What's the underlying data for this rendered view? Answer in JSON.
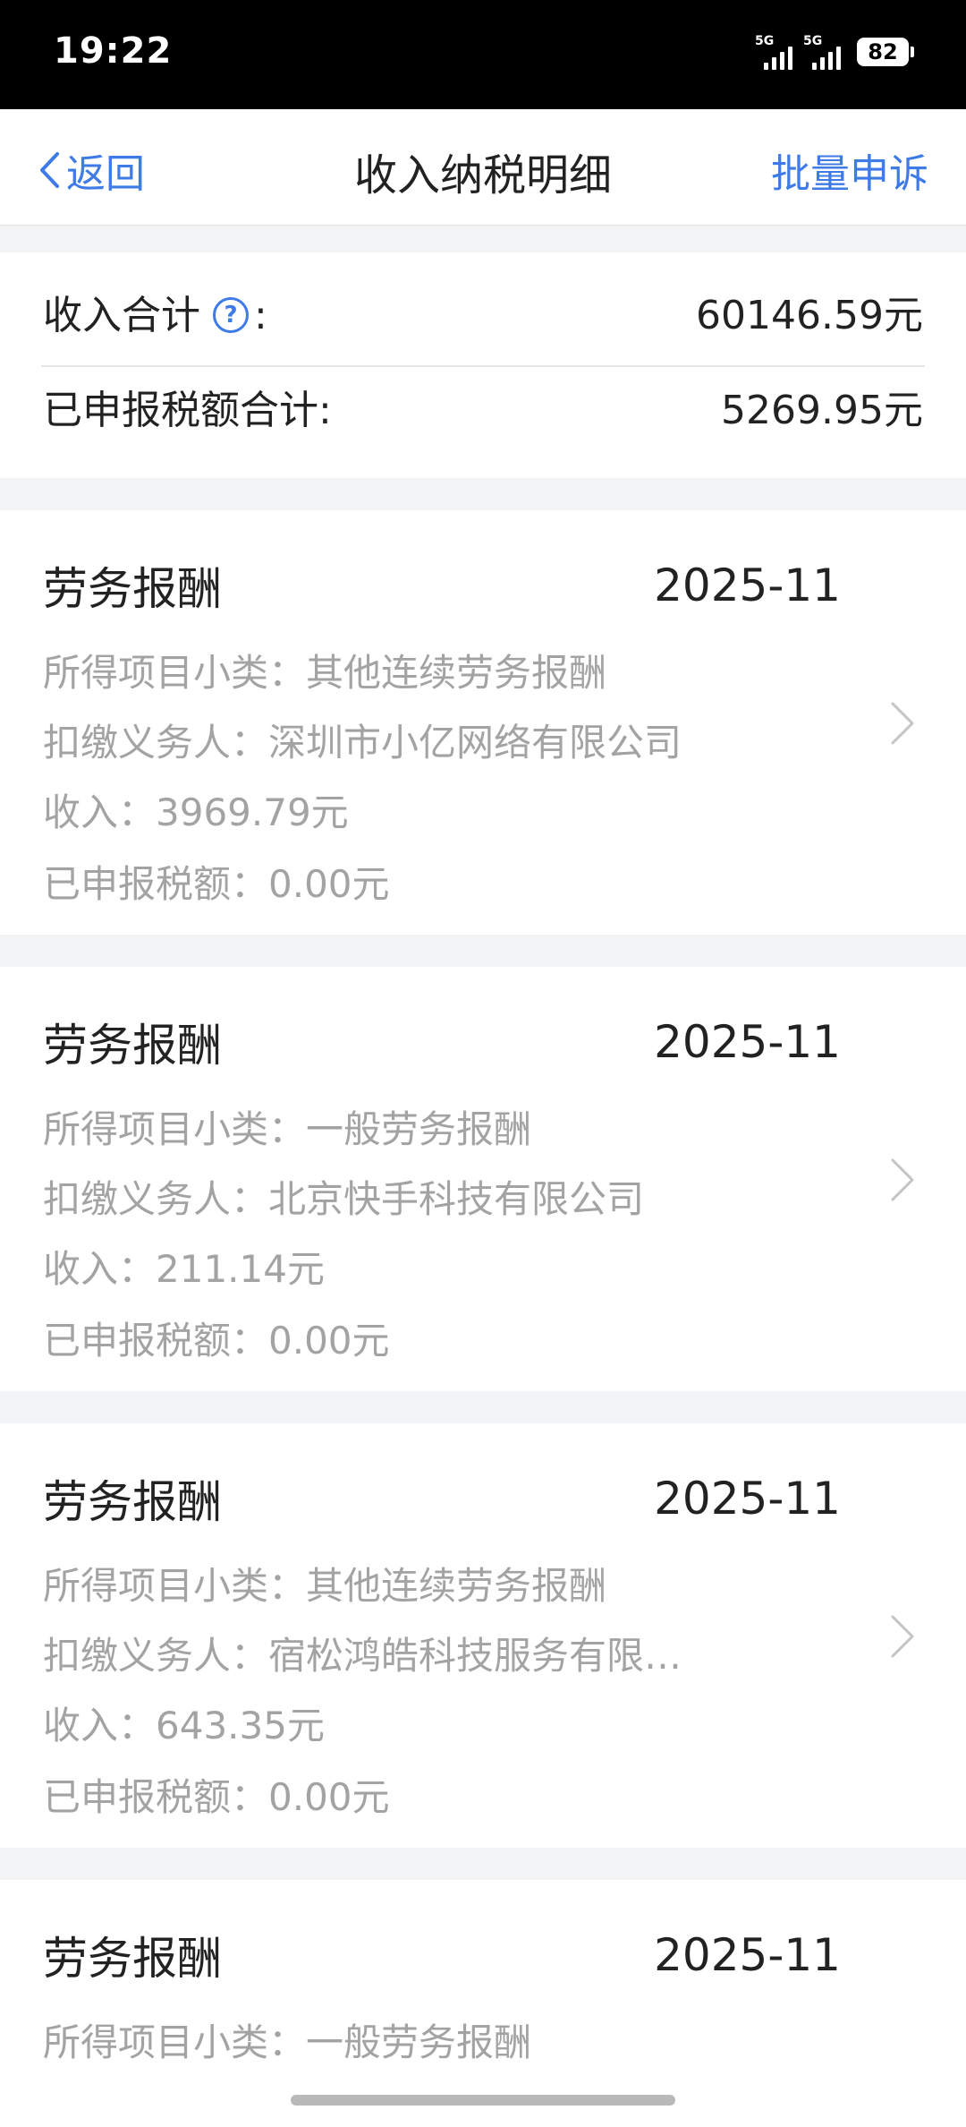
{
  "status_bar": {
    "time": "19:22",
    "signal1_label": "5G",
    "signal2_label": "5G",
    "battery": "82"
  },
  "nav": {
    "back_label": "返回",
    "title": "收入纳税明细",
    "action_label": "批量申诉"
  },
  "summary": {
    "income_label": "收入合计",
    "income_colon": ":",
    "income_value": "60146.59元",
    "tax_label": "已申报税额合计:",
    "tax_value": "5269.95元"
  },
  "records": [
    {
      "type": "劳务报酬",
      "period": "2025-11",
      "subcategory": "所得项目小类：其他连续劳务报酬",
      "withholder": "扣缴义务人：深圳市小亿网络有限公司",
      "income": "收入：3969.79元",
      "tax": "已申报税额：0.00元"
    },
    {
      "type": "劳务报酬",
      "period": "2025-11",
      "subcategory": "所得项目小类：一般劳务报酬",
      "withholder": "扣缴义务人：北京快手科技有限公司",
      "income": "收入：211.14元",
      "tax": "已申报税额：0.00元"
    },
    {
      "type": "劳务报酬",
      "period": "2025-11",
      "subcategory": "所得项目小类：其他连续劳务报酬",
      "withholder": "扣缴义务人：宿松鸿皓科技服务有限…",
      "income": "收入：643.35元",
      "tax": "已申报税额：0.00元"
    },
    {
      "type": "劳务报酬",
      "period": "2025-11",
      "subcategory": "所得项目小类：一般劳务报酬"
    }
  ],
  "colors": {
    "accent": "#3f7be6",
    "secondary_text": "#a3a3a3",
    "background": "#f2f3f5"
  }
}
